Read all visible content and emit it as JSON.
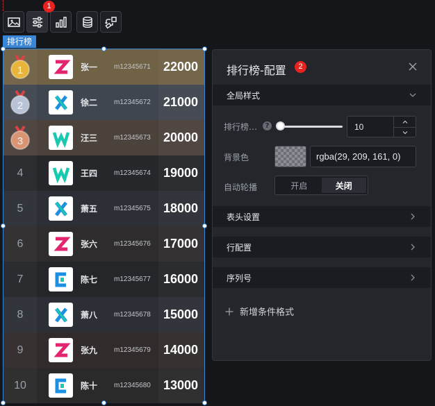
{
  "toolbar": {
    "buttons": [
      {
        "icon": "image-icon"
      },
      {
        "icon": "sliders-icon",
        "badge": "1"
      },
      {
        "icon": "bar-chart-icon"
      },
      {
        "icon": "database-icon"
      },
      {
        "icon": "link-transform-icon"
      }
    ]
  },
  "ranking_tag": "排行榜",
  "ranking": [
    {
      "rank": "1",
      "medal": "gold",
      "name": "张一",
      "code": "m12345671",
      "score": "22000",
      "logo": "Z",
      "row_bg": "#6f6245"
    },
    {
      "rank": "2",
      "medal": "silver",
      "name": "徐二",
      "code": "m12345672",
      "score": "21000",
      "logo": "X",
      "row_bg": "#40464f"
    },
    {
      "rank": "3",
      "medal": "bronze",
      "name": "汪三",
      "code": "m12345673",
      "score": "20000",
      "logo": "W",
      "row_bg": "#4b423c"
    },
    {
      "rank": "4",
      "medal": "",
      "name": "王四",
      "code": "m12345674",
      "score": "19000",
      "logo": "W",
      "row_bg": "#25272b"
    },
    {
      "rank": "5",
      "medal": "",
      "name": "萧五",
      "code": "m12345675",
      "score": "18000",
      "logo": "X",
      "row_bg": "#2c3036"
    },
    {
      "rank": "6",
      "medal": "",
      "name": "张六",
      "code": "m12345676",
      "score": "17000",
      "logo": "Z",
      "row_bg": "#2e2c2c"
    },
    {
      "rank": "7",
      "medal": "",
      "name": "陈七",
      "code": "m12345677",
      "score": "16000",
      "logo": "C",
      "row_bg": "#252629"
    },
    {
      "rank": "8",
      "medal": "",
      "name": "萧八",
      "code": "m12345678",
      "score": "15000",
      "logo": "X",
      "row_bg": "#2c3036"
    },
    {
      "rank": "9",
      "medal": "",
      "name": "张九",
      "code": "m12345679",
      "score": "14000",
      "logo": "Z",
      "row_bg": "#312c2b"
    },
    {
      "rank": "10",
      "medal": "",
      "name": "陈十",
      "code": "m12345680",
      "score": "13000",
      "logo": "C",
      "row_bg": "#2a2a2b"
    }
  ],
  "panel": {
    "title": "排行榜-配置",
    "badge": "2",
    "sections": {
      "global": "全局样式",
      "header": "表头设置",
      "row": "行配置",
      "index": "序列号"
    },
    "fields": {
      "rows_label": "排行榜…",
      "rows_value": "10",
      "rows_slider_fraction": 0.0,
      "bg_label": "背景色",
      "bg_value": "rgba(29, 209, 161, 0)",
      "autoplay_label": "自动轮播",
      "autoplay_on": "开启",
      "autoplay_off": "关闭",
      "autoplay_selected": "关闭"
    },
    "add_condition": "新增条件格式"
  },
  "colors": {
    "accent": "#3a86d6",
    "badge_red": "#e8231f",
    "logo_pink": "#e1266f",
    "logo_blue": "#1b8fe0",
    "logo_teal": "#19c9b0",
    "gold": "#e8b53a",
    "silver": "#b9c3d6",
    "bronze": "#d89473"
  }
}
